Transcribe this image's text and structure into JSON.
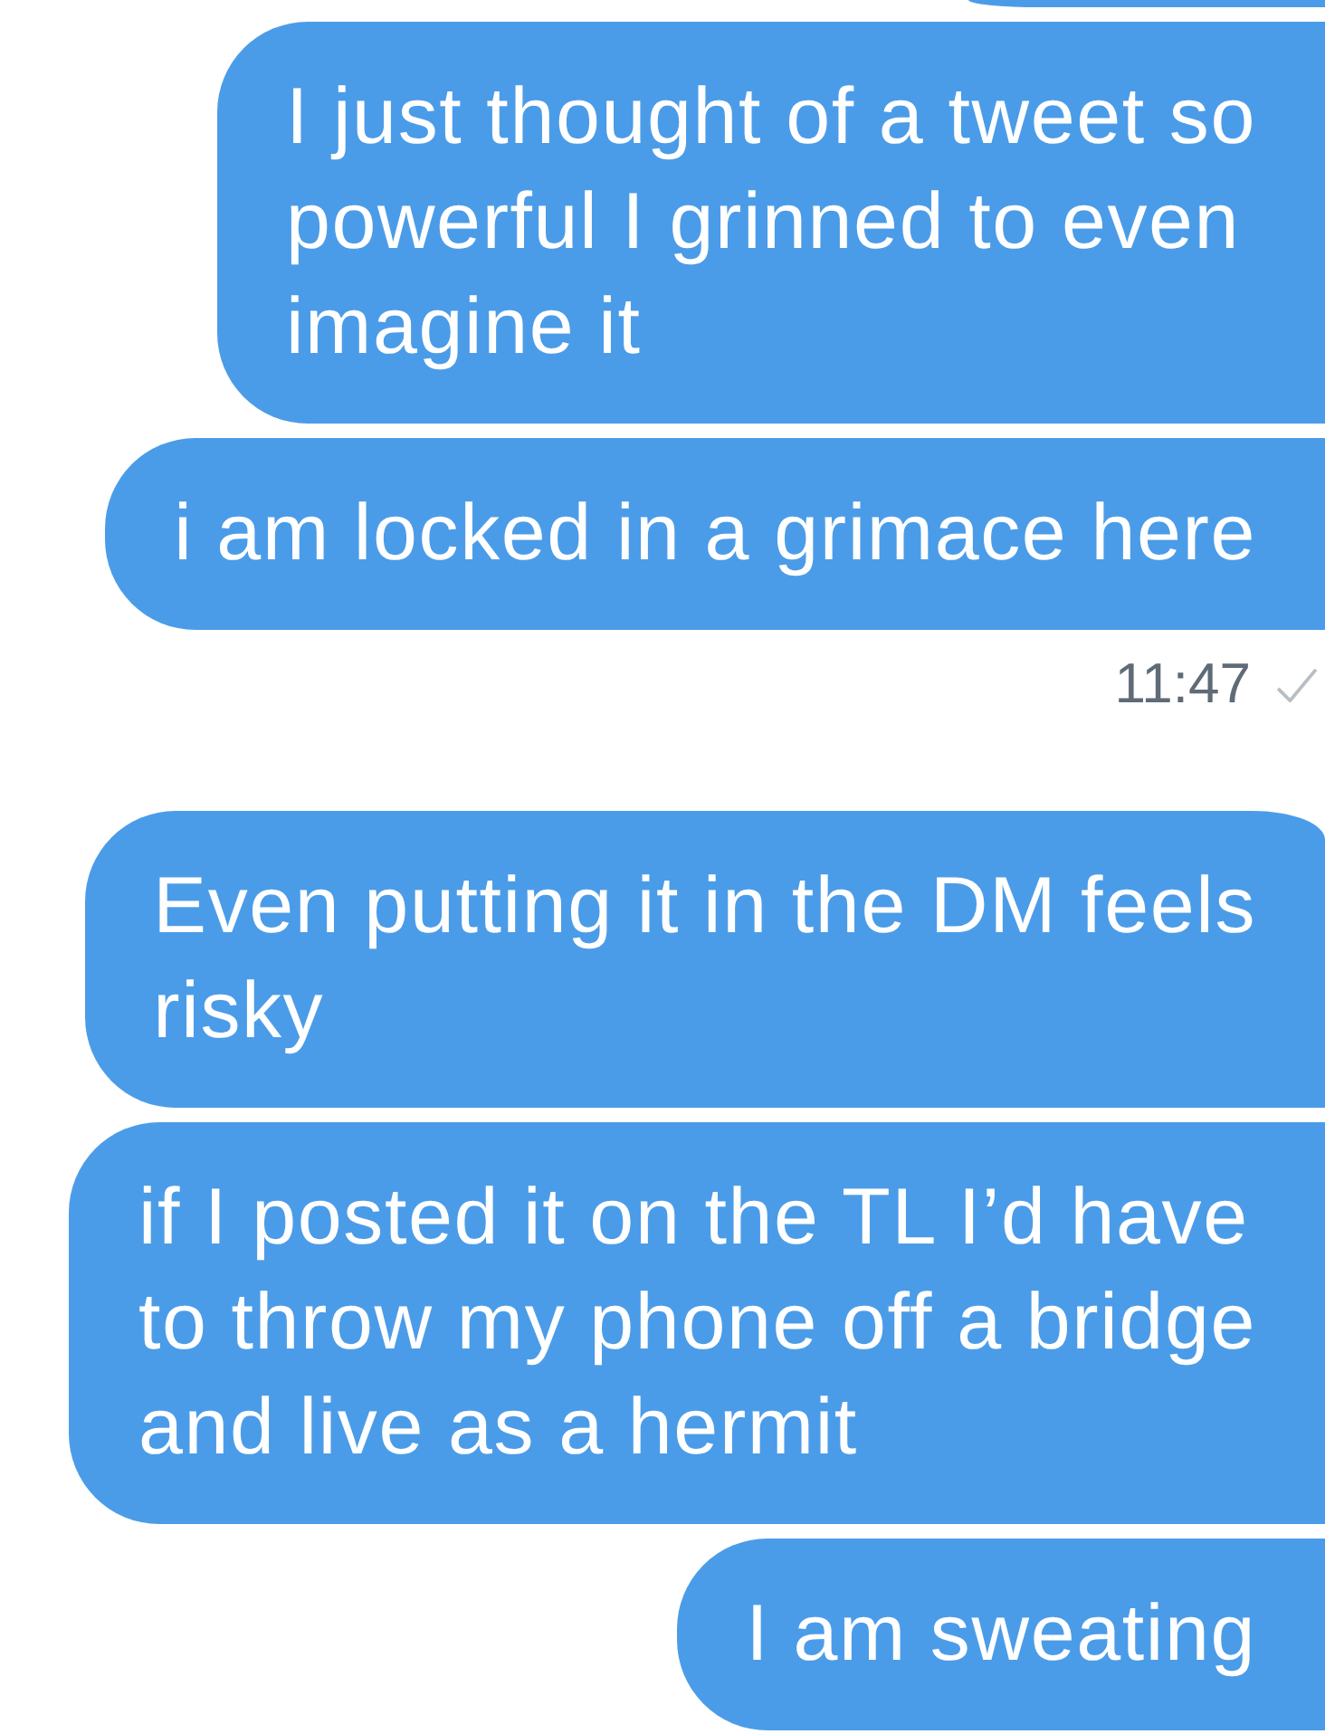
{
  "messages": [
    {
      "kind": "bubble",
      "text": "I just thought of a tweet so\npowerful I grinned to even\nimagine it",
      "rounded_top": false
    },
    {
      "kind": "bubble",
      "text": "i am locked in a grimace here",
      "rounded_top": false
    },
    {
      "kind": "timestamp",
      "time": "11:47",
      "delivered": true
    },
    {
      "kind": "bubble",
      "text": "Even putting it in the DM feels\nrisky",
      "rounded_top": true
    },
    {
      "kind": "bubble",
      "text": "if I posted it on the TL I’d have\nto throw my phone off a bridge\nand live as a hermit",
      "rounded_top": false
    },
    {
      "kind": "bubble",
      "text": "I am sweating",
      "rounded_top": false
    }
  ]
}
